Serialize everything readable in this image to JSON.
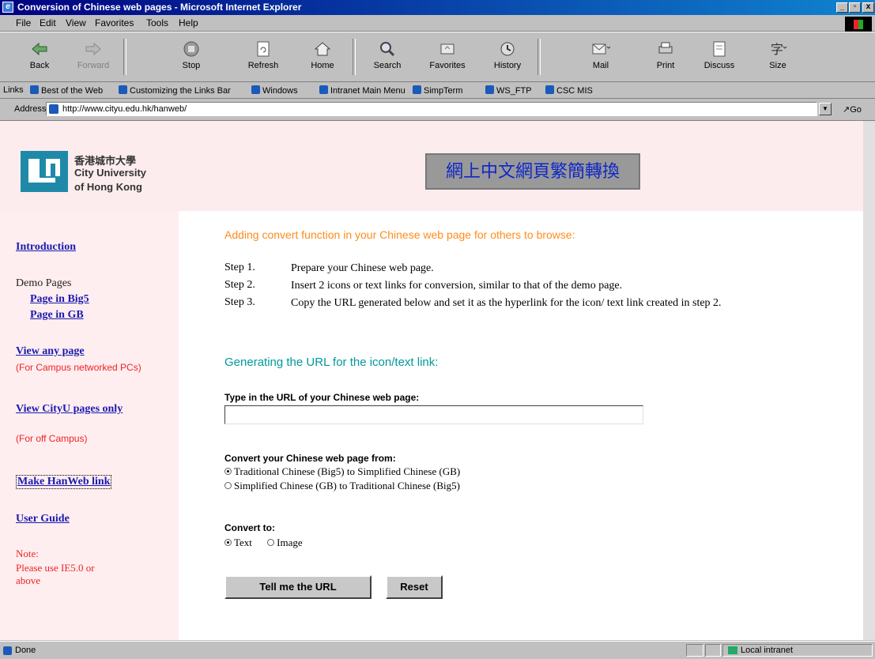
{
  "window": {
    "title": "Conversion of Chinese web pages - Microsoft Internet Explorer",
    "controls": [
      "_",
      "▫",
      "x"
    ]
  },
  "menu": [
    {
      "label": "File"
    },
    {
      "label": "Edit"
    },
    {
      "label": "View"
    },
    {
      "label": "Favorites"
    },
    {
      "label": "Tools"
    },
    {
      "label": "Help"
    }
  ],
  "toolbar": {
    "back": "Back",
    "forward": "Forward",
    "stop": "Stop",
    "refresh": "Refresh",
    "home": "Home",
    "search": "Search",
    "favorites": "Favorites",
    "history": "History",
    "mail": "Mail",
    "print": "Print",
    "discuss": "Discuss",
    "size": "Size"
  },
  "links": {
    "label": "Links",
    "items": [
      "Best of the Web",
      "Customizing the Links Bar",
      "Windows",
      "Intranet Main Menu",
      "SimpTerm",
      "WS_FTP",
      "CSC MIS"
    ]
  },
  "address": {
    "label": "Address",
    "url": "http://www.cityu.edu.hk/hanweb/",
    "go": "Go"
  },
  "logo": {
    "zh": "香港城市大學",
    "en1": "City University",
    "en2": "of Hong Kong"
  },
  "banner": "網上中文網頁繁簡轉換",
  "sidebar": {
    "introduction": "Introduction",
    "demo_head": "Demo Pages",
    "demo_big5": "Page in Big5",
    "demo_gb": "Page in GB",
    "view_any": "View any page",
    "view_any_note": "(For Campus networked PCs)",
    "view_cityu": "View CityU pages only",
    "view_cityu_note": "(For off Campus)",
    "make_link": "Make HanWeb link",
    "user_guide": "User Guide",
    "note_label": "Note:",
    "note_text": "Please use IE5.0 or above"
  },
  "main": {
    "heading": "Adding convert function in your Chinese web page for others to browse:",
    "steps": [
      {
        "num": "Step 1.",
        "text": "Prepare your Chinese web page."
      },
      {
        "num": "Step 2.",
        "text": "Insert 2 icons or text links for conversion, similar to that of the demo page."
      },
      {
        "num": "Step 3.",
        "text": "Copy the URL generated below and set it as the hyperlink for the icon/ text link created in step 2."
      }
    ],
    "subheading": "Generating the URL for the icon/text link:",
    "url_label": "Type in the URL of your Chinese web page:",
    "url_value": "",
    "convert_from_label": "Convert your Chinese web page from:",
    "from_options": [
      {
        "label": "Traditional Chinese (Big5) to Simplified Chinese (GB)",
        "selected": true
      },
      {
        "label": "Simplified Chinese (GB) to Traditional Chinese (Big5)",
        "selected": false
      }
    ],
    "convert_to_label": "Convert to:",
    "to_options": [
      {
        "label": "Text",
        "selected": true
      },
      {
        "label": "Image",
        "selected": false
      }
    ],
    "submit_label": "Tell me the URL",
    "reset_label": "Reset"
  },
  "status": {
    "text": "Done",
    "zone": "Local intranet"
  }
}
